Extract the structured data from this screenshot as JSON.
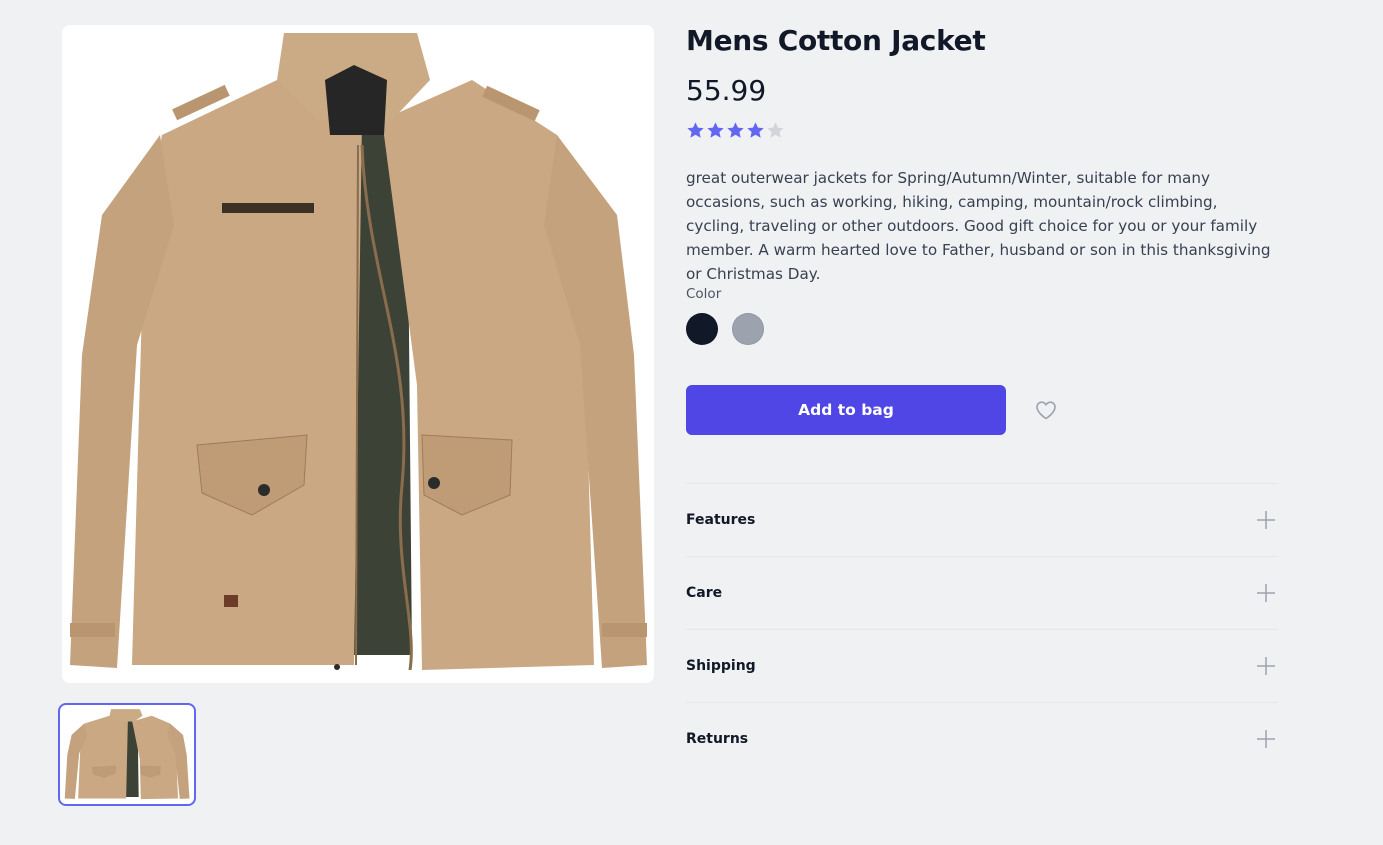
{
  "product": {
    "title": "Mens Cotton Jacket",
    "price": "55.99",
    "rating": 4,
    "rating_max": 5,
    "description": "great outerwear jackets for Spring/Autumn/Winter, suitable for many occasions, such as working, hiking, camping, mountain/rock climbing, cycling, traveling or other outdoors. Good gift choice for you or your family member. A warm hearted love to Father, husband or son in this thanksgiving or Christmas Day."
  },
  "color": {
    "label": "Color",
    "options": [
      {
        "swatch": "#111827"
      },
      {
        "swatch": "#9ca3af"
      }
    ]
  },
  "actions": {
    "add_to_bag": "Add to bag",
    "wishlist_icon": "heart-icon"
  },
  "accordion": [
    {
      "label": "Features",
      "icon": "plus-icon"
    },
    {
      "label": "Care",
      "icon": "plus-icon"
    },
    {
      "label": "Shipping",
      "icon": "plus-icon"
    },
    {
      "label": "Returns",
      "icon": "plus-icon"
    }
  ],
  "colors": {
    "accent": "#4f46e5",
    "star_filled": "#6366f1",
    "star_empty": "#d1d5db",
    "background": "#f0f1f3"
  }
}
